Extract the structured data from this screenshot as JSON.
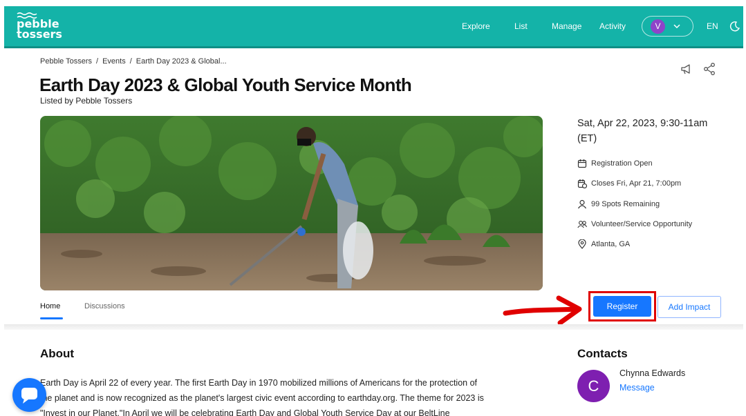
{
  "header": {
    "logo_line1": "pebble",
    "logo_line2": "tossers",
    "nav": [
      "Explore",
      "List",
      "Manage",
      "Activity"
    ],
    "user_initial": "V",
    "language": "EN"
  },
  "breadcrumb": [
    "Pebble Tossers",
    "Events",
    "Earth Day 2023 & Global..."
  ],
  "event": {
    "title": "Earth Day 2023 & Global Youth Service Month",
    "listed_by": "Listed by Pebble Tossers",
    "date_line1": "Sat, Apr 22, 2023, 9:30-11am",
    "date_line2": "(ET)",
    "details": [
      {
        "icon": "calendar-icon",
        "text": "Registration Open"
      },
      {
        "icon": "calendar-clock-icon",
        "text": "Closes Fri, Apr 21, 7:00pm"
      },
      {
        "icon": "person-icon",
        "text": "99 Spots Remaining"
      },
      {
        "icon": "people-icon",
        "text": "Volunteer/Service Opportunity"
      },
      {
        "icon": "location-pin-icon",
        "text": "Atlanta, GA"
      }
    ]
  },
  "tabs": [
    "Home",
    "Discussions"
  ],
  "actions": {
    "register": "Register",
    "add_impact": "Add Impact"
  },
  "about": {
    "heading": "About",
    "lines": [
      "Earth Day is April 22 of every year. The first Earth Day in 1970 mobilized millions of Americans for the protection of",
      "the planet and is now recognized as the planet's largest civic event according to earthday.org. The theme for 2023 is",
      "\"Invest in our Planet.\"In April we will be celebrating Earth Day and Global Youth Service Day at our BeltLine"
    ]
  },
  "contacts": {
    "heading": "Contacts",
    "name": "Chynna Edwards",
    "initial": "C",
    "message": "Message"
  },
  "colors": {
    "brand": "#14b3a8",
    "accent": "#1677ff",
    "highlight": "#e00000"
  }
}
